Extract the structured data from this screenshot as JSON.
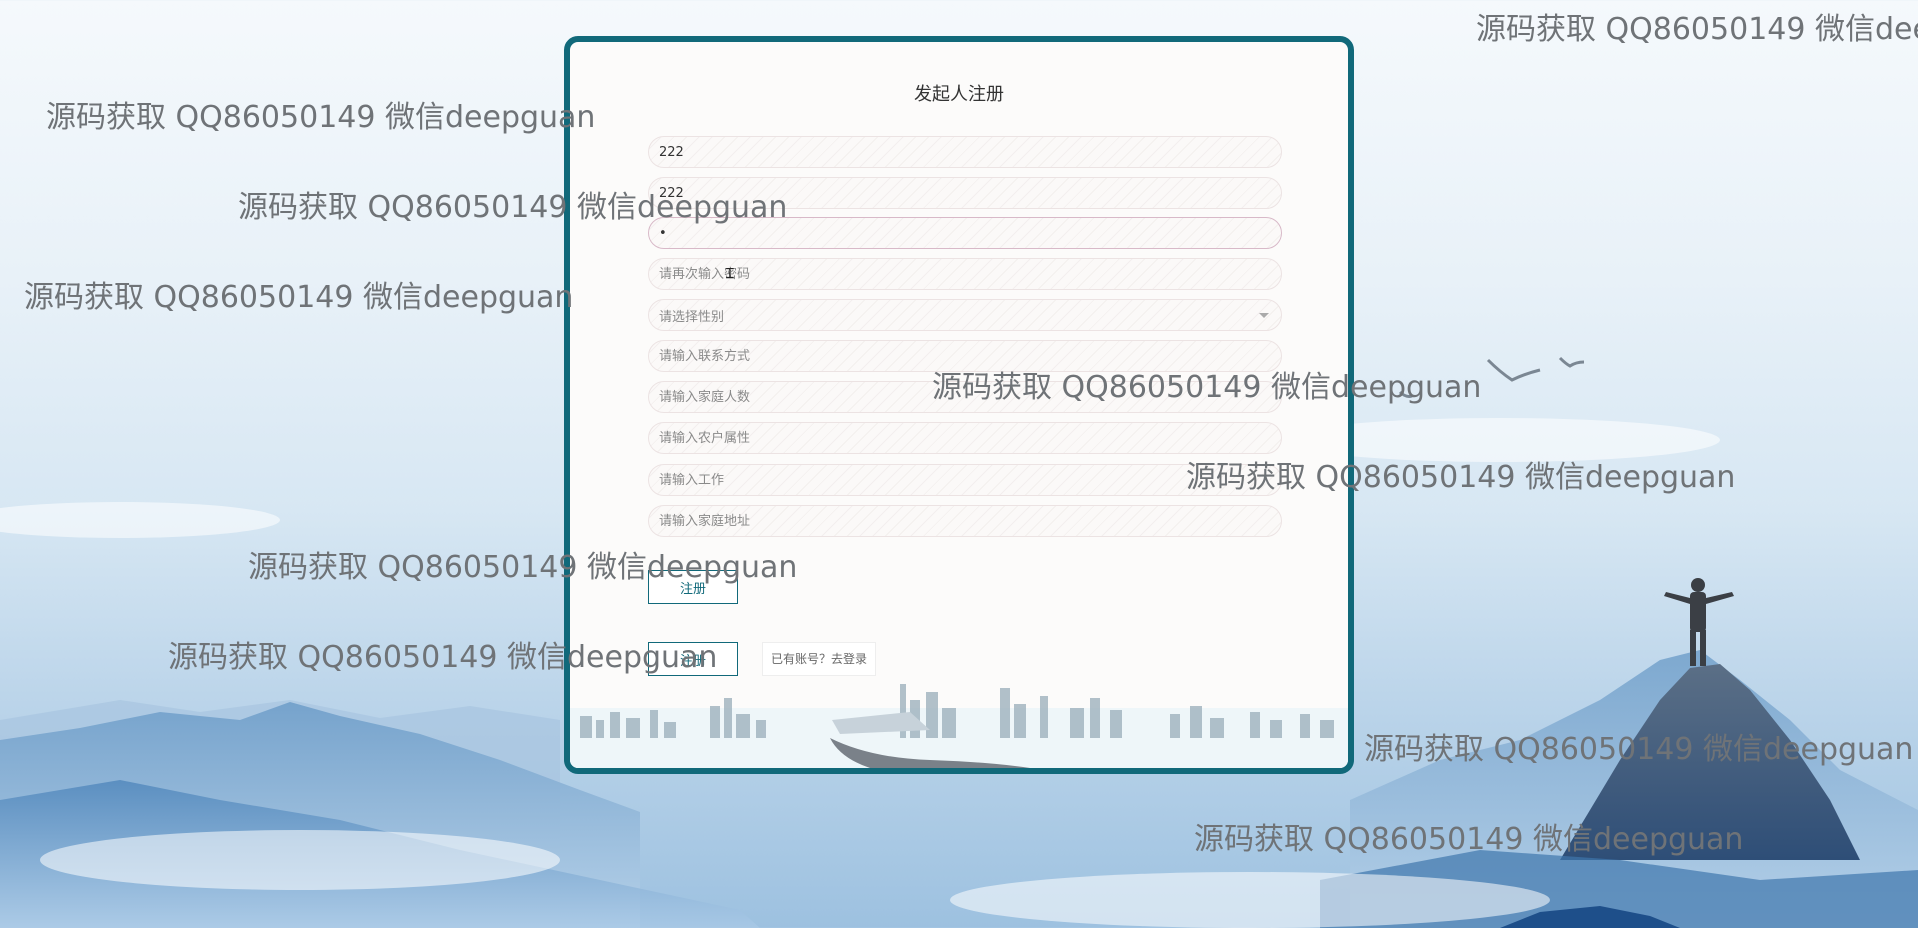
{
  "form": {
    "title": "发起人注册",
    "fields": [
      {
        "name": "account-input",
        "value": "222",
        "placeholder": ""
      },
      {
        "name": "name-input",
        "value": "222",
        "placeholder": ""
      },
      {
        "name": "password-input",
        "value": "•",
        "placeholder": ""
      },
      {
        "name": "confirm-password-input",
        "value": "",
        "placeholder": "请再次输入密码"
      },
      {
        "name": "contact-input",
        "value": "",
        "placeholder": "请输入联系方式"
      },
      {
        "name": "family-size-input",
        "value": "",
        "placeholder": "请输入家庭人数"
      },
      {
        "name": "household-type-input",
        "value": "",
        "placeholder": "请输入农户属性"
      },
      {
        "name": "job-input",
        "value": "",
        "placeholder": "请输入工作"
      },
      {
        "name": "address-input",
        "value": "",
        "placeholder": "请输入家庭地址"
      }
    ],
    "gender_select": {
      "placeholder": "请选择性别"
    },
    "register_label": "注册",
    "second_button_label": "注册",
    "login_link": "已有账号？去登录"
  },
  "watermark": "源码获取 QQ86050149 微信deepguan",
  "watermark_cut": "源码获取 QQ86050149 微信dee",
  "colors": {
    "accent": "#11697a",
    "card_bg": "#fcfbfa"
  },
  "icons": {
    "select_arrow": "chevron-down-icon",
    "text_cursor": "text-cursor-icon"
  }
}
